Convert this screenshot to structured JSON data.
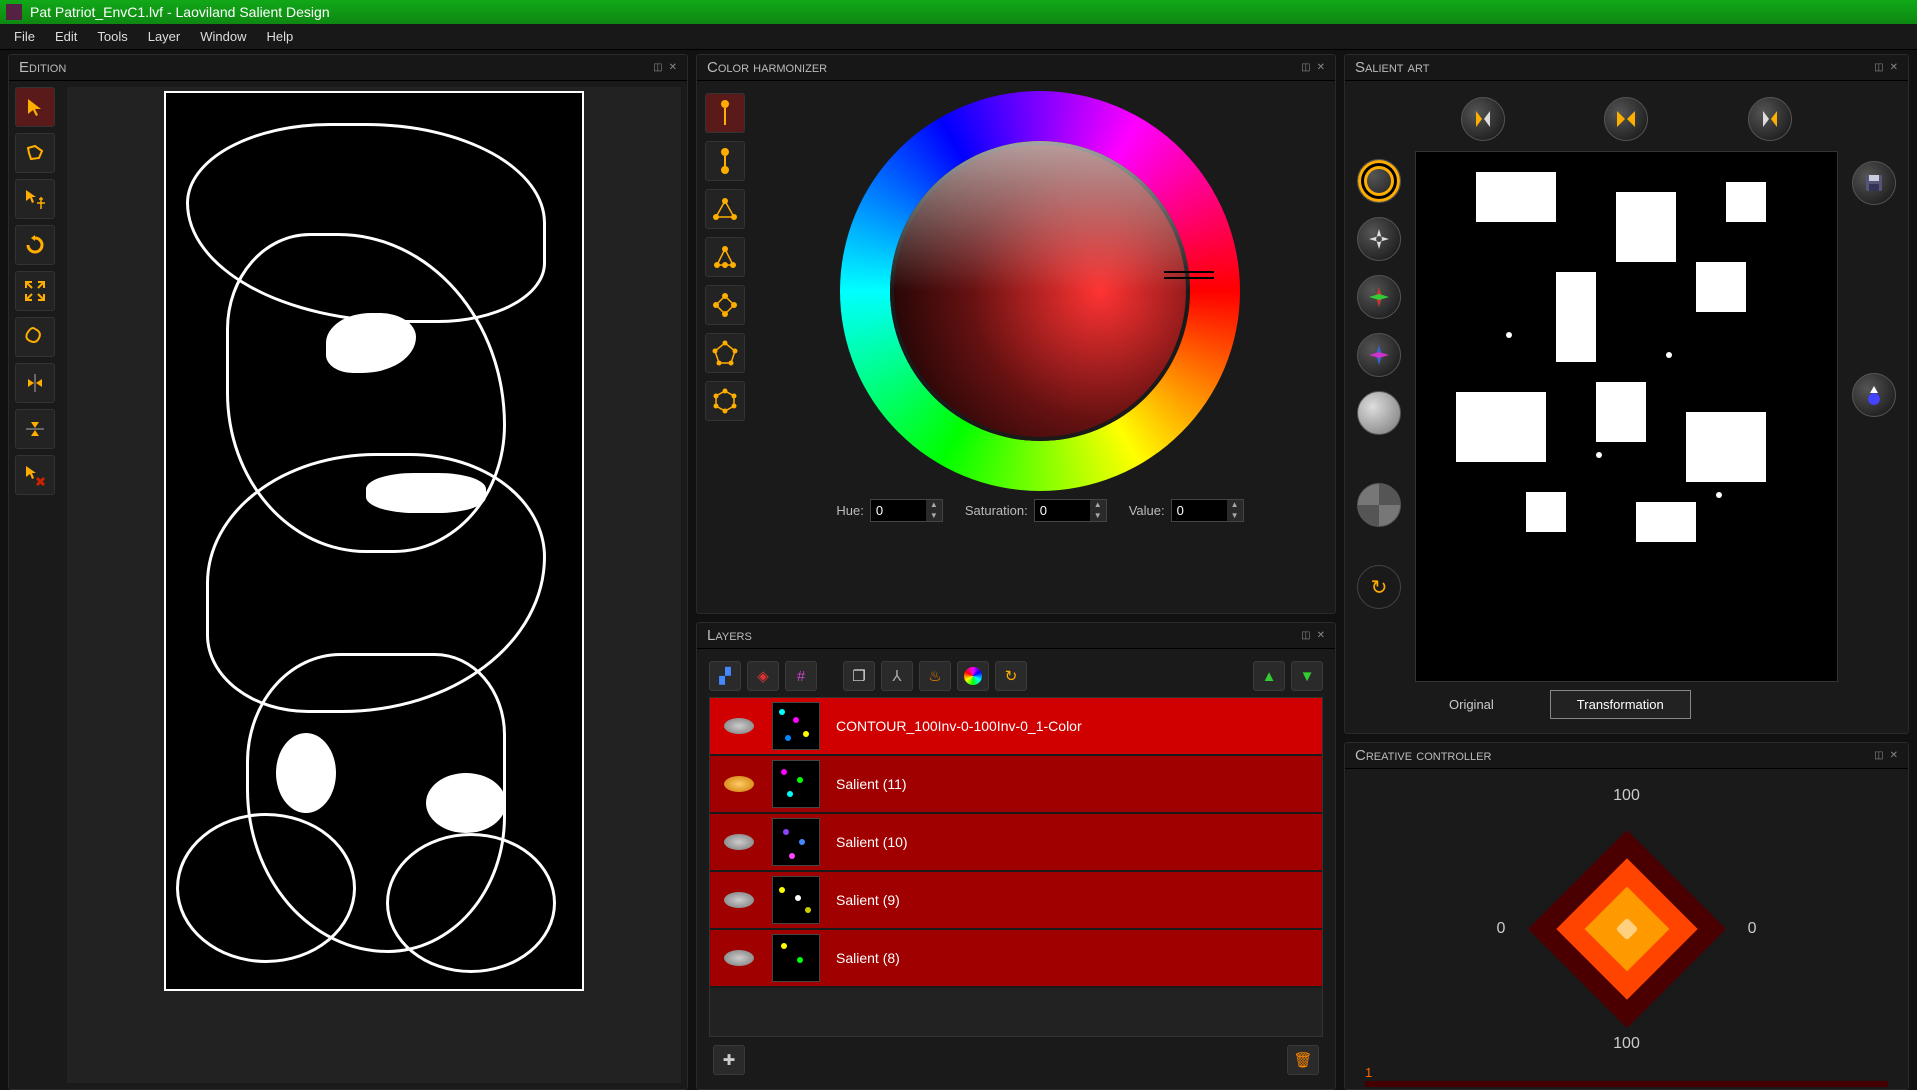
{
  "titlebar": {
    "title": "Pat Patriot_EnvC1.lvf - Laoviland Salient Design"
  },
  "menubar": {
    "file": "File",
    "edit": "Edit",
    "tools": "Tools",
    "layer": "Layer",
    "window": "Window",
    "help": "Help"
  },
  "panels": {
    "edition": {
      "title": "Edition"
    },
    "harmonizer": {
      "title": "Color harmonizer"
    },
    "layers": {
      "title": "Layers"
    },
    "salient": {
      "title": "Salient art"
    },
    "creative": {
      "title": "Creative controller"
    }
  },
  "hsv": {
    "hue_label": "Hue:",
    "sat_label": "Saturation:",
    "val_label": "Value:",
    "hue": "0",
    "sat": "0",
    "val": "0"
  },
  "layers_list": [
    {
      "name": "CONTOUR_100Inv-0-100Inv-0_1-Color",
      "selected": true
    },
    {
      "name": "Salient (11)",
      "selected": false
    },
    {
      "name": "Salient (10)",
      "selected": false
    },
    {
      "name": "Salient (9)",
      "selected": false
    },
    {
      "name": "Salient (8)",
      "selected": false
    }
  ],
  "salient": {
    "tab_original": "Original",
    "tab_transformation": "Transformation"
  },
  "creative": {
    "top": "100",
    "bottom": "100",
    "left": "0",
    "right": "0",
    "slider_mark": "1"
  },
  "icons": {
    "harmony_point": "●",
    "harmony_pair": "⬤—⬤"
  }
}
